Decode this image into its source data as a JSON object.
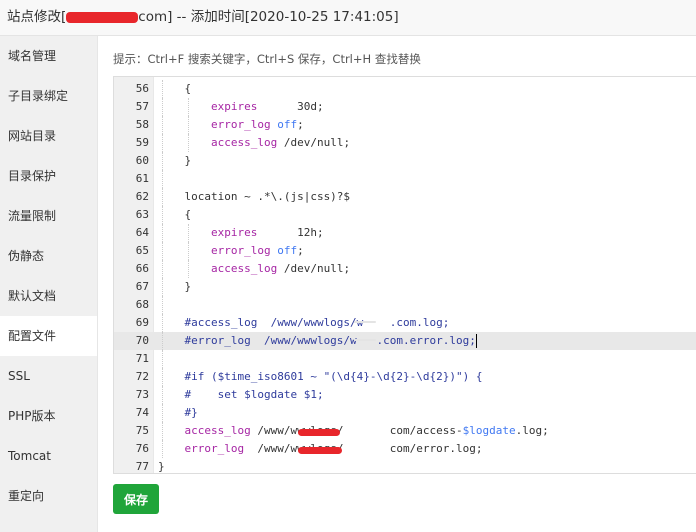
{
  "window": {
    "title_prefix": "站点修改[",
    "title_suffix": "com] -- 添加时间[2020-10-25 17:41:05]"
  },
  "sidebar": {
    "items": [
      {
        "label": "域名管理"
      },
      {
        "label": "子目录绑定"
      },
      {
        "label": "网站目录"
      },
      {
        "label": "目录保护"
      },
      {
        "label": "流量限制"
      },
      {
        "label": "伪静态"
      },
      {
        "label": "默认文档"
      },
      {
        "label": "配置文件",
        "active": true
      },
      {
        "label": "SSL"
      },
      {
        "label": "PHP版本"
      },
      {
        "label": "Tomcat"
      },
      {
        "label": "重定向"
      }
    ]
  },
  "main": {
    "hint": "提示：Ctrl+F 搜索关键字，Ctrl+S 保存，Ctrl+H 查找替换",
    "save_label": "保存"
  },
  "editor": {
    "current_line": 70,
    "lines": [
      {
        "n": "56",
        "guides": 1,
        "segs": [
          [
            "    {",
            ""
          ]
        ]
      },
      {
        "n": "57",
        "guides": 2,
        "segs": [
          [
            "        ",
            ""
          ],
          [
            "expires",
            "p"
          ],
          [
            "      30d;",
            ""
          ]
        ]
      },
      {
        "n": "58",
        "guides": 2,
        "segs": [
          [
            "        ",
            ""
          ],
          [
            "error_log",
            "p"
          ],
          [
            " ",
            ""
          ],
          [
            "off",
            "b"
          ],
          [
            ";",
            ""
          ]
        ]
      },
      {
        "n": "59",
        "guides": 2,
        "segs": [
          [
            "        ",
            ""
          ],
          [
            "access_log",
            "p"
          ],
          [
            " /dev/null;",
            ""
          ]
        ]
      },
      {
        "n": "60",
        "guides": 1,
        "segs": [
          [
            "    }",
            ""
          ]
        ]
      },
      {
        "n": "61",
        "guides": 1,
        "segs": [
          [
            "",
            ""
          ]
        ]
      },
      {
        "n": "62",
        "guides": 1,
        "segs": [
          [
            "    location ~ .*\\.(js|css)?$",
            ""
          ]
        ]
      },
      {
        "n": "63",
        "guides": 1,
        "segs": [
          [
            "    {",
            ""
          ]
        ]
      },
      {
        "n": "64",
        "guides": 2,
        "segs": [
          [
            "        ",
            ""
          ],
          [
            "expires",
            "p"
          ],
          [
            "      12h;",
            ""
          ]
        ]
      },
      {
        "n": "65",
        "guides": 2,
        "segs": [
          [
            "        ",
            ""
          ],
          [
            "error_log",
            "p"
          ],
          [
            " ",
            ""
          ],
          [
            "off",
            "b"
          ],
          [
            ";",
            ""
          ]
        ]
      },
      {
        "n": "66",
        "guides": 2,
        "segs": [
          [
            "        ",
            ""
          ],
          [
            "access_log",
            "p"
          ],
          [
            " /dev/null;",
            ""
          ]
        ]
      },
      {
        "n": "67",
        "guides": 1,
        "segs": [
          [
            "    }",
            ""
          ]
        ]
      },
      {
        "n": "68",
        "guides": 1,
        "segs": [
          [
            "",
            ""
          ]
        ]
      },
      {
        "n": "69",
        "guides": 1,
        "segs": [
          [
            "    #access_log  /www/wwwlogs/w    .com.log;",
            "c"
          ]
        ]
      },
      {
        "n": "70",
        "guides": 1,
        "segs": [
          [
            "    #error_log  /www/wwwlogs/w   .com.error.log;",
            "c"
          ]
        ],
        "cursor": true
      },
      {
        "n": "71",
        "guides": 1,
        "segs": [
          [
            "",
            ""
          ]
        ]
      },
      {
        "n": "72",
        "guides": 1,
        "segs": [
          [
            "    #if ($time_iso8601 ~ \"(\\d{4}-\\d{2}-\\d{2})\") {",
            "c"
          ]
        ]
      },
      {
        "n": "73",
        "guides": 1,
        "segs": [
          [
            "    #    set $logdate $1;",
            "c"
          ]
        ]
      },
      {
        "n": "74",
        "guides": 1,
        "segs": [
          [
            "    #}",
            "c"
          ]
        ]
      },
      {
        "n": "75",
        "guides": 1,
        "segs": [
          [
            "    ",
            ""
          ],
          [
            "access_log",
            "p"
          ],
          [
            " /www/wwwlogs/       com/access-",
            ""
          ],
          [
            "$logdate",
            "b"
          ],
          [
            ".log;",
            ""
          ]
        ]
      },
      {
        "n": "76",
        "guides": 1,
        "segs": [
          [
            "    ",
            ""
          ],
          [
            "error_log",
            "p"
          ],
          [
            "  /www/wwwlogs/       com/error.log;",
            ""
          ]
        ]
      },
      {
        "n": "77",
        "guides": 0,
        "segs": [
          [
            "}",
            ""
          ]
        ]
      }
    ]
  }
}
